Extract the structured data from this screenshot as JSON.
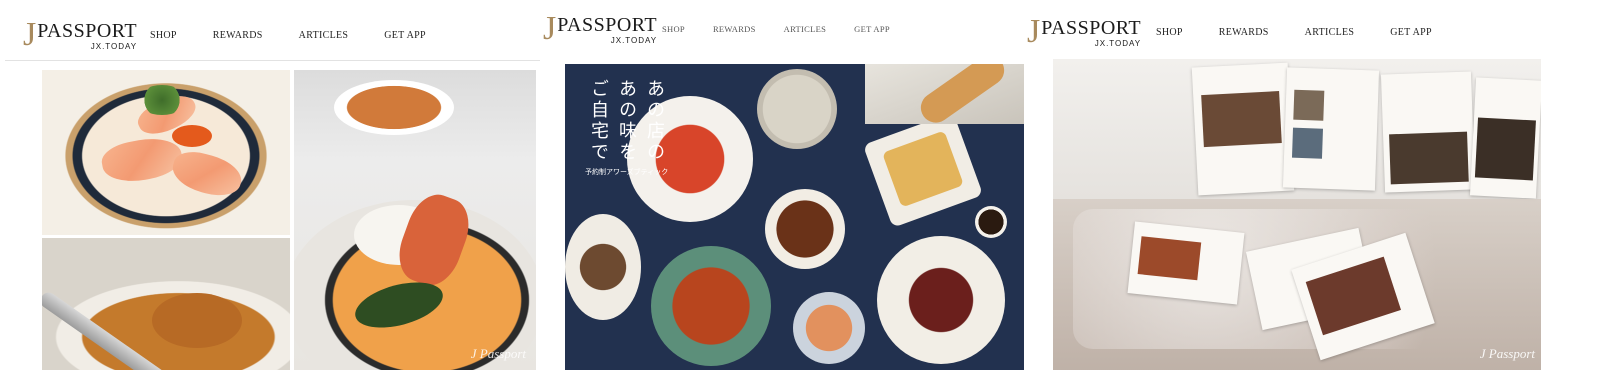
{
  "brand": {
    "letter": "J",
    "name": "PASSPORT",
    "sub": "JX.TODAY"
  },
  "nav": [
    "SHOP",
    "REWARDS",
    "ARTICLES",
    "GET APP"
  ],
  "promo": {
    "line1": "あの店の",
    "line2": "あの味を",
    "line3": "ご自宅で",
    "tagline": "予約制アワーズブティック"
  },
  "watermark": "J Passport"
}
